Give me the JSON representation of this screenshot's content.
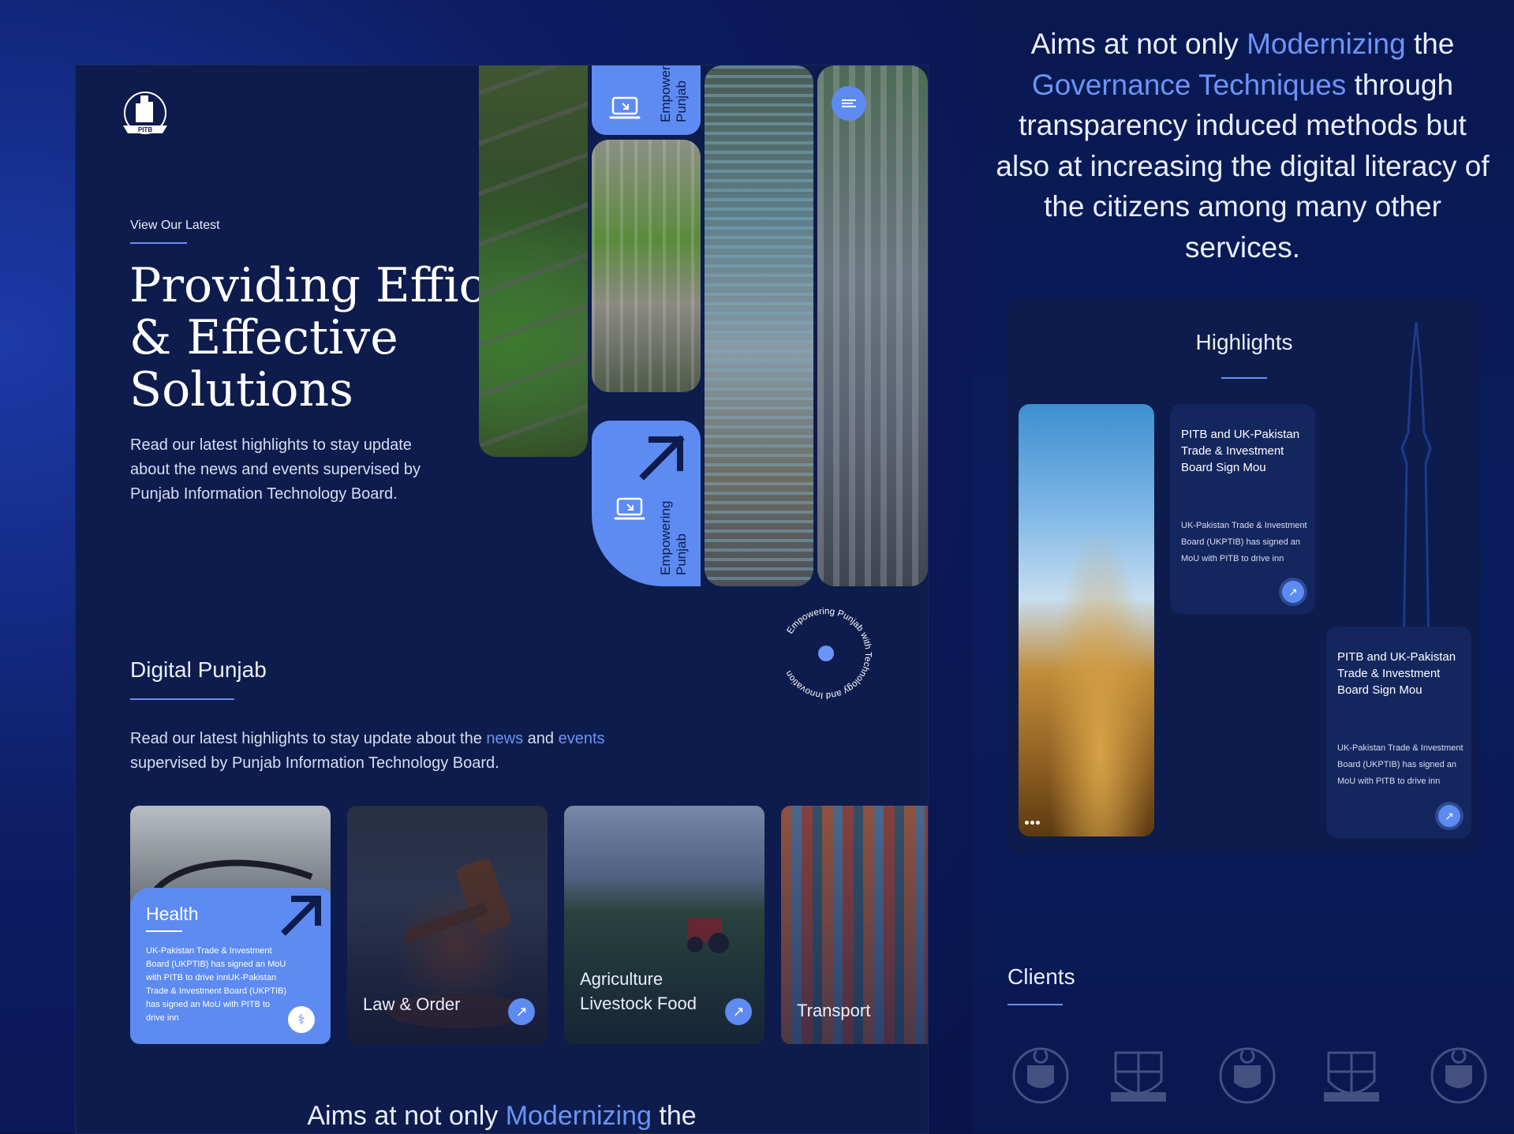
{
  "hero": {
    "eyebrow": "View Our Latest",
    "title_lines": [
      "Providing Efficient",
      "& Effective",
      "Solutions"
    ],
    "description": "Read our latest highlights to stay update about the news and events supervised by Punjab Information Technology Board."
  },
  "logo": {
    "text": "PITB"
  },
  "side_tabs": {
    "top_label_lines": [
      "Empowering",
      "Punjab"
    ],
    "bottom_label_lines": [
      "Empowering",
      "Punjab"
    ]
  },
  "badge": {
    "text": "Empowering Punjab with Technology and Innovation"
  },
  "digital_punjab": {
    "title": "Digital Punjab",
    "desc_part1": "Read our latest highlights to stay update about the ",
    "desc_news": "news",
    "desc_and": " and ",
    "desc_events": "events",
    "desc_part2": "supervised by Punjab Information Technology Board."
  },
  "sectors": [
    {
      "label": "Health",
      "description": "UK-Pakistan Trade & Investment Board (UKPTIB) has signed an MoU with PITB to drive innUK-Pakistan Trade & Investment Board (UKPTIB) has signed an MoU with PITB to drive inn",
      "icon": "stethoscope-icon"
    },
    {
      "label": "Law & Order",
      "icon": "arrow-up-right-icon"
    },
    {
      "label_line1": "Agriculture",
      "label_line2": "Livestock Food",
      "icon": "arrow-up-right-icon"
    },
    {
      "label": "Transport"
    }
  ],
  "bottom_peek": {
    "part1": "Aims at not only ",
    "highlight": "Modernizing",
    "part2": " the"
  },
  "aims": {
    "part1": "Aims at not only ",
    "hl1": "Modernizing",
    "part2": " the ",
    "hl2": "Governance Techniques",
    "part3": " through transparency induced methods but also at increasing the digital literacy of the citizens among many other services."
  },
  "highlights": {
    "title": "Highlights",
    "items": [
      {
        "title": "PITB and UK-Pakistan Trade & Investment Board Sign Mou",
        "description": "UK-Pakistan Trade & Investment Board (UKPTIB) has signed an MoU with PITB to drive inn"
      },
      {
        "title": "PITB and UK-Pakistan Trade & Investment Board Sign Mou",
        "description": "UK-Pakistan Trade & Investment Board (UKPTIB) has signed an MoU with PITB to drive inn"
      }
    ]
  },
  "clients": {
    "title": "Clients",
    "logos": [
      "punjab-govt-emblem",
      "psca-crest",
      "punjab-govt-emblem",
      "psca-crest",
      "punjab-govt-emblem"
    ]
  },
  "colors": {
    "accent": "#5d8bf1",
    "highlight_text": "#6b94f7",
    "panel": "#0d1c4c",
    "background": "#0a1446"
  }
}
